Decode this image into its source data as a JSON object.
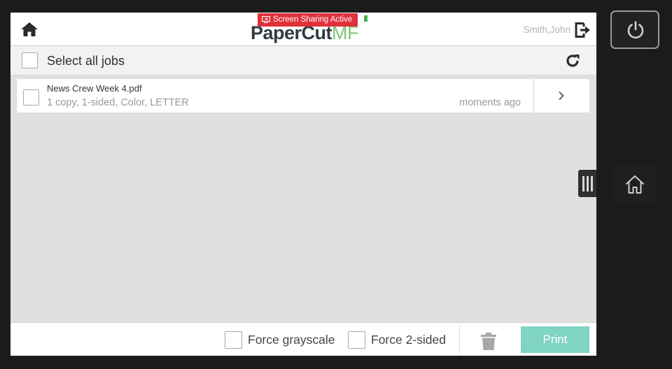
{
  "header": {
    "banner_text": "Screen Sharing Active",
    "logo_primary": "PaperCut",
    "logo_secondary": "MF",
    "user_name": "Smith,John",
    "icons": {
      "home": "home-icon",
      "logout": "logout-icon",
      "screen_share": "screen-share-icon"
    }
  },
  "selection": {
    "select_all_label": "Select all jobs",
    "refresh_icon": "refresh-icon"
  },
  "jobs": [
    {
      "name": "News Crew Week 4.pdf",
      "details": "1 copy, 1-sided, Color, LETTER",
      "time": "moments ago",
      "selected": false
    }
  ],
  "footer": {
    "force_grayscale_label": "Force grayscale",
    "force_2sided_label": "Force 2-sided",
    "print_label": "Print",
    "trash_icon": "trash-icon"
  },
  "device": {
    "power_icon": "power-icon",
    "home_icon": "home-outline-icon",
    "side_handle_icon": "handle-icon"
  },
  "colors": {
    "banner": "#e0303a",
    "logo_dark": "#333a41",
    "logo_green": "#7cc576",
    "print_button": "#7fd4c4",
    "frame": "#1b1b1b",
    "content_bg": "#e0e0e0"
  }
}
